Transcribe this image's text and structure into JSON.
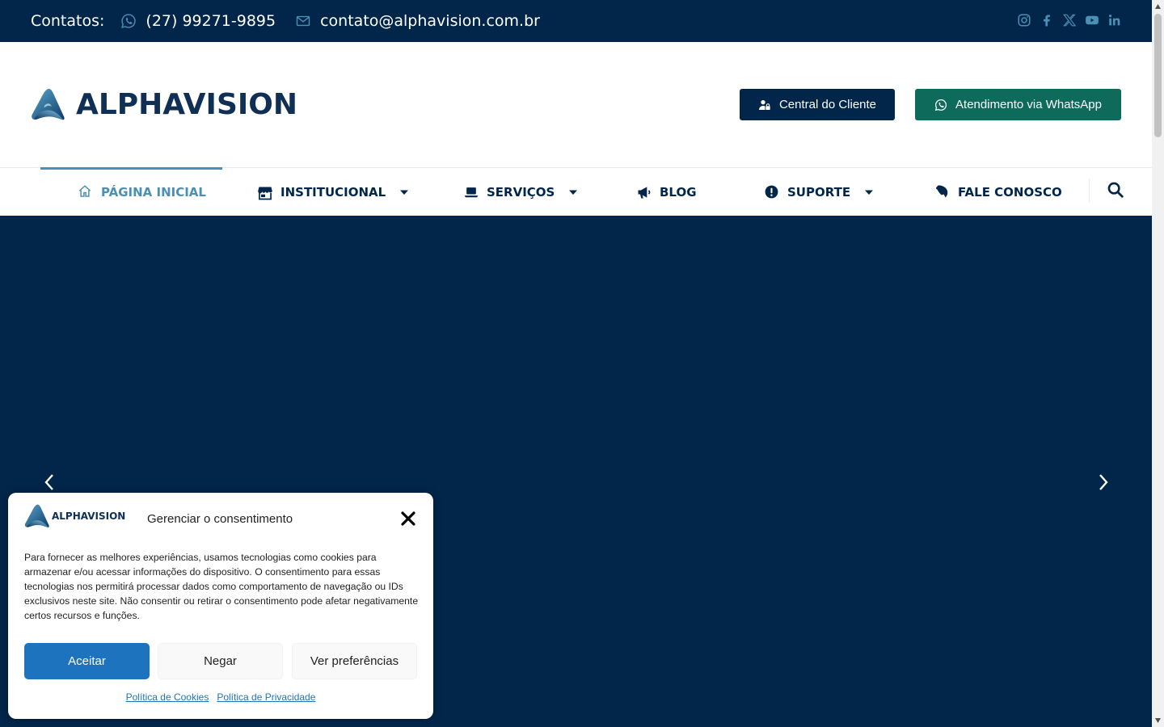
{
  "topbar": {
    "contacts_label": "Contatos:",
    "phone": "(27) 99271-9895",
    "email": "contato@alphavision.com.br",
    "social": [
      "instagram-icon",
      "facebook-icon",
      "x-icon",
      "youtube-icon",
      "linkedin-icon"
    ]
  },
  "header": {
    "logo_text": "ALPHAVISION",
    "client_button": "Central do Cliente",
    "whatsapp_button": "Atendimento via WhatsApp"
  },
  "nav": {
    "items": [
      {
        "label": "PÁGINA INICIAL",
        "icon": "home-icon",
        "active": true,
        "dropdown": false
      },
      {
        "label": "INSTITUCIONAL",
        "icon": "store-icon",
        "active": false,
        "dropdown": true
      },
      {
        "label": "SERVIÇOS",
        "icon": "laptop-icon",
        "active": false,
        "dropdown": true
      },
      {
        "label": "BLOG",
        "icon": "megaphone-icon",
        "active": false,
        "dropdown": false
      },
      {
        "label": "SUPORTE",
        "icon": "exclamation-icon",
        "active": false,
        "dropdown": true
      },
      {
        "label": "FALE CONOSCO",
        "icon": "phone-icon",
        "active": false,
        "dropdown": false
      }
    ]
  },
  "consent": {
    "logo_text": "ALPHAVISION",
    "title": "Gerenciar o consentimento",
    "body": "Para fornecer as melhores experiências, usamos tecnologias como cookies para armazenar e/ou acessar informações do dispositivo. O consentimento para essas tecnologias nos permitirá processar dados como comportamento de navegação ou IDs exclusivos neste site. Não consentir ou retirar o consentimento pode afetar negativamente certos recursos e funções.",
    "accept": "Aceitar",
    "deny": "Negar",
    "preferences": "Ver preferências",
    "cookie_policy": "Política de Cookies",
    "privacy_policy": "Política de Privacidade"
  },
  "colors": {
    "navy": "#02264a",
    "accent_blue": "#4b8fb5",
    "whatsapp_green": "#0e6b5b",
    "accept_blue": "#1e73be"
  }
}
